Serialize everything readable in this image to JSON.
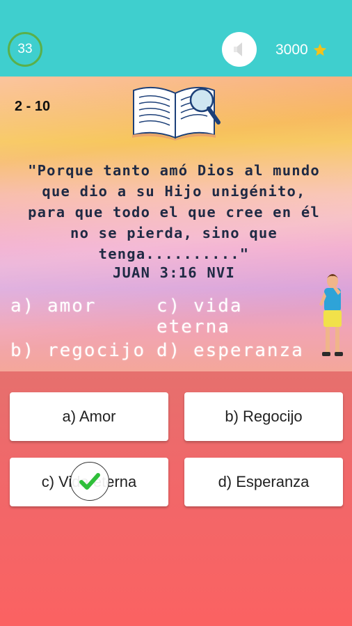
{
  "header": {
    "timer": "33",
    "sound_icon": "speaker-icon",
    "score": "3000",
    "score_icon": "star-icon"
  },
  "question": {
    "counter": "2 - 10",
    "text": "\"Porque tanto amó Dios al mundo que dio a su Hijo unigénito, para que todo el que cree en él no se pierda, sino que tenga..........\"",
    "reference": "JUAN 3:16 NVI",
    "options": {
      "a": "a) amor",
      "b": "b) regocijo",
      "c": "c) vida eterna",
      "d": "d) esperanza"
    }
  },
  "answers": {
    "a": "a) Amor",
    "b": "b) Regocijo",
    "c": "c) Vida eterna",
    "d": "d) Esperanza"
  },
  "feedback": {
    "icon": "checkmark-icon",
    "color": "#2fbf3a"
  },
  "colors": {
    "header_bg": "#3fcfce",
    "timer_ring": "#5ab04a",
    "star": "#f3c21b",
    "question_text": "#1f2a44"
  }
}
